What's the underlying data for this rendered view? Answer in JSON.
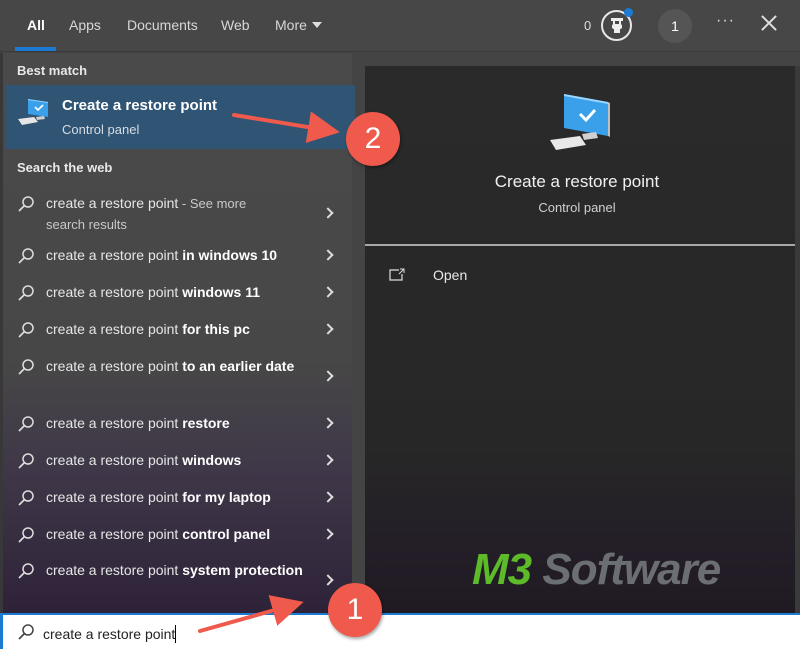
{
  "tabs": [
    {
      "label": "All",
      "active": true
    },
    {
      "label": "Apps"
    },
    {
      "label": "Documents"
    },
    {
      "label": "Web"
    },
    {
      "label": "More"
    }
  ],
  "header": {
    "points": "0",
    "trophy_icon": "trophy-icon",
    "avatar_label": "1",
    "more_options": "···",
    "close_icon": "close-icon"
  },
  "best_match": {
    "section_label": "Best match",
    "title": "Create a restore point",
    "subtitle": "Control panel",
    "icon": "computer-check-icon"
  },
  "web": {
    "section_label": "Search the web",
    "items": [
      {
        "base": "create a restore point",
        "bold": "",
        "suffix": " - See more",
        "line2": "search results"
      },
      {
        "base": "create a restore point ",
        "bold": "in windows 10"
      },
      {
        "base": "create a restore point ",
        "bold": "windows 11"
      },
      {
        "base": "create a restore point ",
        "bold": "for this pc"
      },
      {
        "base": "create a restore point ",
        "bold": "to an earlier date"
      },
      {
        "base": "create a restore point ",
        "bold": "restore"
      },
      {
        "base": "create a restore point ",
        "bold": "windows"
      },
      {
        "base": "create a restore point ",
        "bold": "for my laptop"
      },
      {
        "base": "create a restore point ",
        "bold": "control panel"
      },
      {
        "base": "create a restore point ",
        "bold": "system protection"
      }
    ]
  },
  "preview": {
    "title": "Create a restore point",
    "subtitle": "Control panel",
    "actions": [
      {
        "label": "Open",
        "icon": "open-window-icon"
      }
    ]
  },
  "search": {
    "value": "create a restore point",
    "icon": "search-icon"
  },
  "annotations": {
    "badge1": "1",
    "badge2": "2",
    "color": "#ef5a4c"
  },
  "watermark": {
    "part1": "M3",
    "part2": " Software"
  },
  "colors": {
    "accent": "#1a7ad4",
    "selected_bg": "#2f5474",
    "logo_green": "#5dbb2a"
  }
}
